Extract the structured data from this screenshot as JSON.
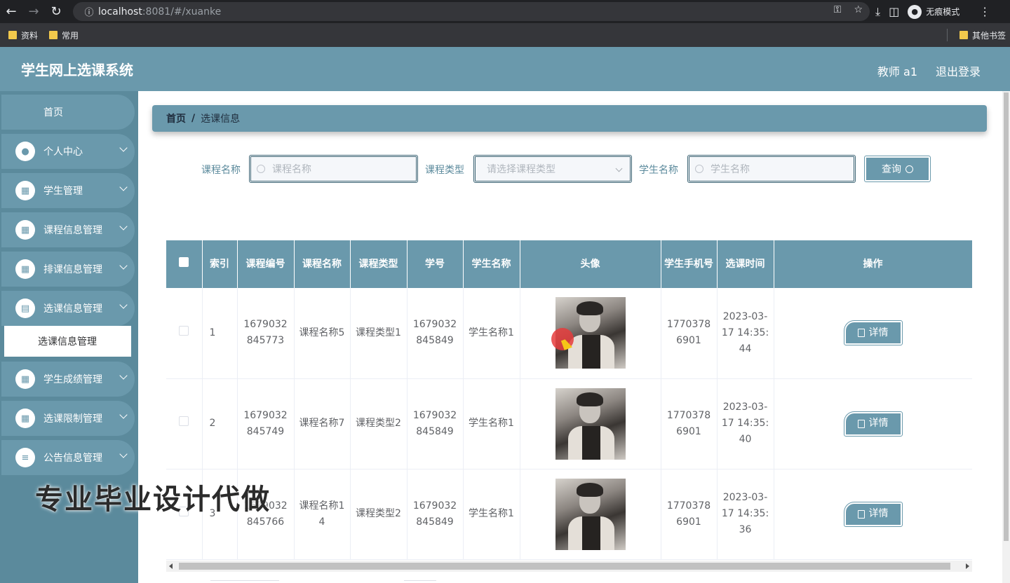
{
  "browser": {
    "url_host": "localhost",
    "url_rest": ":8081/#/xuanke",
    "incognito_label": "无痕模式",
    "bookmarks": [
      "资料",
      "常用"
    ],
    "other_bookmarks": "其他书签"
  },
  "header": {
    "title": "学生网上选课系统",
    "user": "教师 a1",
    "logout": "退出登录"
  },
  "sidebar": {
    "home": "首页",
    "items": [
      {
        "label": "个人中心",
        "icon": "user-icon"
      },
      {
        "label": "学生管理",
        "icon": "grid-icon"
      },
      {
        "label": "课程信息管理",
        "icon": "grid-icon"
      },
      {
        "label": "排课信息管理",
        "icon": "grid-icon"
      },
      {
        "label": "选课信息管理",
        "icon": "briefcase-icon"
      },
      {
        "label": "学生成绩管理",
        "icon": "grid-icon"
      },
      {
        "label": "选课限制管理",
        "icon": "grid-icon"
      },
      {
        "label": "公告信息管理",
        "icon": "list-icon"
      }
    ],
    "active_sub": "选课信息管理"
  },
  "breadcrumb": {
    "home": "首页",
    "sep": "/",
    "current": "选课信息"
  },
  "search": {
    "course_name_label": "课程名称",
    "course_name_placeholder": "课程名称",
    "course_type_label": "课程类型",
    "course_type_placeholder": "请选择课程类型",
    "student_name_label": "学生名称",
    "student_name_placeholder": "学生名称",
    "query_label": "查询"
  },
  "table": {
    "columns": [
      "索引",
      "课程编号",
      "课程名称",
      "课程类型",
      "学号",
      "学生名称",
      "头像",
      "学生手机号",
      "选课时间",
      "操作"
    ],
    "detail_label": "详情",
    "rows": [
      {
        "index": "1",
        "course_no": "1679032845773",
        "course_name": "课程名称5",
        "course_type": "课程类型1",
        "student_no": "1679032845849",
        "student_name": "学生名称1",
        "phone": "17703786901",
        "time": "2023-03-17 14:35:44"
      },
      {
        "index": "2",
        "course_no": "1679032845749",
        "course_name": "课程名称7",
        "course_type": "课程类型2",
        "student_no": "1679032845849",
        "student_name": "学生名称1",
        "phone": "17703786901",
        "time": "2023-03-17 14:35:40"
      },
      {
        "index": "3",
        "course_no": "1679032845766",
        "course_name": "课程名称14",
        "course_type": "课程类型2",
        "student_no": "1679032845849",
        "student_name": "学生名称1",
        "phone": "17703786901",
        "time": "2023-03-17 14:35:36"
      }
    ]
  },
  "watermark": "专业毕业设计代做",
  "colors": {
    "primary": "#6a99ac",
    "sidebar_bg": "#5b8a9c",
    "chrome_dark": "#202124"
  }
}
